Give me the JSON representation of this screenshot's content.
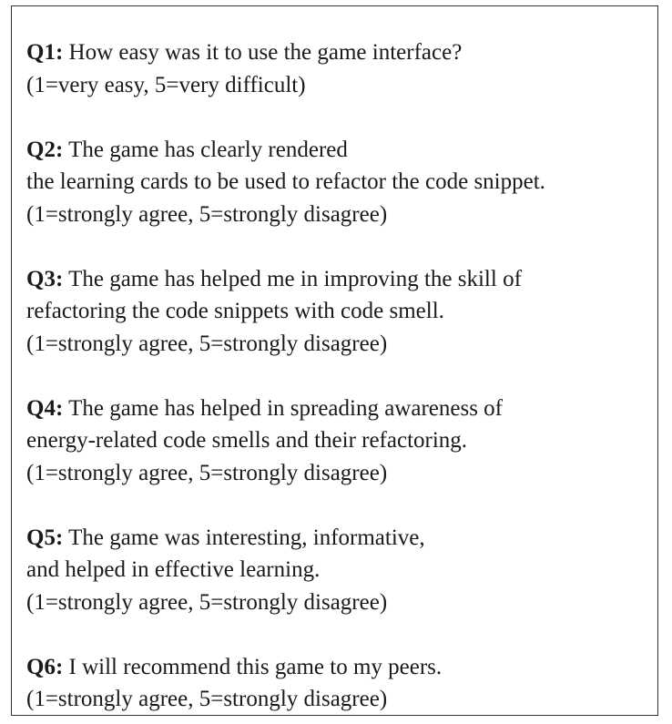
{
  "questions": [
    {
      "label": "Q1:",
      "lines": [
        "How easy was it to use the game interface?"
      ],
      "scale": "(1=very easy, 5=very difficult)"
    },
    {
      "label": "Q2:",
      "lines": [
        "The game has clearly rendered",
        "the learning cards to be used to refactor the code snippet."
      ],
      "scale": "(1=strongly agree, 5=strongly disagree)"
    },
    {
      "label": "Q3:",
      "lines": [
        "The game has helped me in improving the skill of",
        "refactoring the code snippets with code smell."
      ],
      "scale": "(1=strongly agree, 5=strongly disagree)"
    },
    {
      "label": "Q4:",
      "lines": [
        "The game has helped in spreading awareness of",
        "energy-related code smells and their refactoring."
      ],
      "scale": "(1=strongly agree, 5=strongly disagree)"
    },
    {
      "label": "Q5:",
      "lines": [
        "The game was interesting, informative,",
        "and helped in effective learning."
      ],
      "scale": "(1=strongly agree, 5=strongly disagree)"
    },
    {
      "label": "Q6:",
      "lines": [
        "I will recommend this game to my peers."
      ],
      "scale": "(1=strongly agree, 5=strongly disagree)"
    }
  ]
}
